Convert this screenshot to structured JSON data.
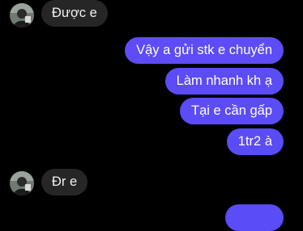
{
  "conversation": {
    "messages": [
      {
        "sender": "contact",
        "text": "Được e"
      },
      {
        "sender": "me",
        "text": "Vậy a gửi stk e chuyển"
      },
      {
        "sender": "me",
        "text": "Làm nhanh kh ạ"
      },
      {
        "sender": "me",
        "text": "Tại e cần gấp"
      },
      {
        "sender": "me",
        "text": "1tr2 à"
      },
      {
        "sender": "contact",
        "text": "Đr e"
      },
      {
        "sender": "me",
        "text": ""
      }
    ]
  },
  "colors": {
    "background": "#000000",
    "incoming_bubble": "#262626",
    "outgoing_bubble": "#5b4cf6",
    "text": "#ffffff"
  },
  "icons": {
    "contact_avatar": "profile-photo"
  }
}
